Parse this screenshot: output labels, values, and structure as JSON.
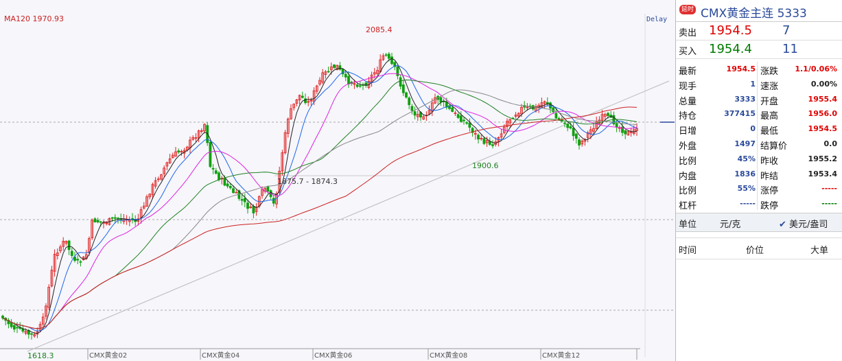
{
  "chart": {
    "ma_label": "MA120  1970.93",
    "delay_label": "Delay",
    "high_label": "2085.4",
    "low_label": "1618.3",
    "mid_low_label": "1900.6",
    "range_label": "1875.7 - 1874.3",
    "x_labels": [
      "CMX黄金02",
      "CMX黄金04",
      "CMX黄金06",
      "CMX黄金08",
      "CMX黄金12"
    ],
    "colors": {
      "up": "#e02020",
      "down": "#10a010",
      "ma120": "#cc2020",
      "ma5": "#222222",
      "ma10": "#1e66e6",
      "ma20": "#e020e0",
      "ma40": "#208020",
      "ma60": "#888888"
    }
  },
  "panel": {
    "badge": "延时",
    "title": "CMX黄金主连  5333",
    "sell": {
      "label": "卖出",
      "price": "1954.5",
      "vol": "7"
    },
    "buy": {
      "label": "买入",
      "price": "1954.4",
      "vol": "11"
    },
    "left": [
      {
        "k": "最新",
        "v": "1954.5",
        "c": "red"
      },
      {
        "k": "现手",
        "v": "1",
        "c": "blue"
      },
      {
        "k": "总量",
        "v": "3333",
        "c": "blue"
      },
      {
        "k": "持仓",
        "v": "377415",
        "c": "blue"
      },
      {
        "k": "日增",
        "v": "0",
        "c": "blue"
      },
      {
        "k": "外盘",
        "v": "1497",
        "c": "blue"
      },
      {
        "k": "比例",
        "v": "45%",
        "c": "blue"
      },
      {
        "k": "内盘",
        "v": "1836",
        "c": "blue"
      },
      {
        "k": "比例",
        "v": "55%",
        "c": "blue"
      },
      {
        "k": "杠杆",
        "v": "-----",
        "c": "blue"
      }
    ],
    "right": [
      {
        "k": "涨跌",
        "v": "1.1/0.06%",
        "c": "red"
      },
      {
        "k": "速涨",
        "v": "0.00%",
        "c": "dark"
      },
      {
        "k": "开盘",
        "v": "1955.4",
        "c": "red"
      },
      {
        "k": "最高",
        "v": "1956.0",
        "c": "red"
      },
      {
        "k": "最低",
        "v": "1954.5",
        "c": "red"
      },
      {
        "k": "结算价",
        "v": "0.0",
        "c": "dark"
      },
      {
        "k": "昨收",
        "v": "1955.2",
        "c": "dark"
      },
      {
        "k": "昨结",
        "v": "1953.4",
        "c": "dark"
      },
      {
        "k": "涨停",
        "v": "-----",
        "c": "red"
      },
      {
        "k": "跌停",
        "v": "-----",
        "c": "green"
      }
    ],
    "unit_label": "单位",
    "unit_value": "元/克",
    "currency_toggle": "美元/盎司",
    "trades_headers": {
      "time": "时间",
      "price": "价位",
      "size": "大单"
    }
  }
}
